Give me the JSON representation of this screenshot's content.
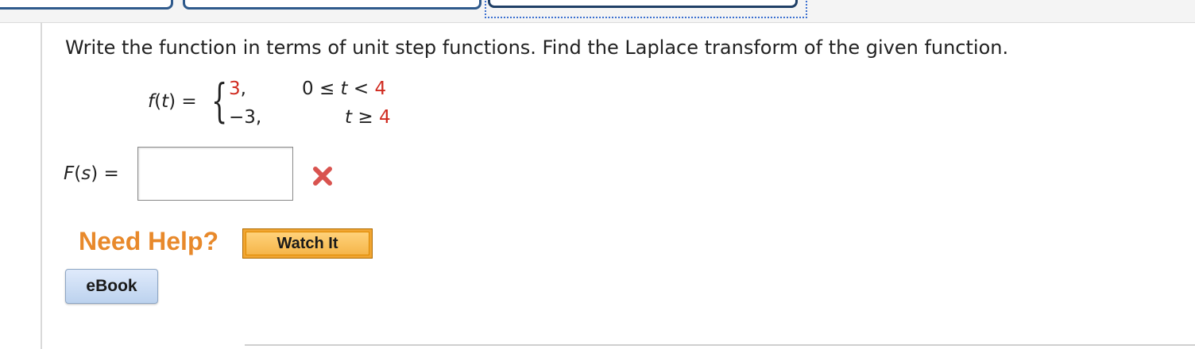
{
  "question": "Write the function in terms of unit step functions. Find the Laplace transform of the given function.",
  "function_def": {
    "lhs": "f(t) =",
    "cases": [
      {
        "value": "3",
        "comma": ",",
        "cond_prefix": "0 ≤ ",
        "cond_var": "t",
        "cond_op": " < ",
        "cond_bound": "4"
      },
      {
        "value": "−3",
        "comma": ",",
        "cond_prefix": "",
        "cond_var": "t",
        "cond_op": " ≥ ",
        "cond_bound": "4"
      }
    ]
  },
  "answer": {
    "label": "F(s) =",
    "value": "",
    "status_icon": "wrong-x-icon",
    "status_color": "#d9534f"
  },
  "help": {
    "title": "Need Help?",
    "watch_label": "Watch It",
    "ebook_label": "eBook"
  },
  "colors": {
    "accent_red": "#d02b20",
    "help_orange": "#e8892b",
    "tab_border": "#2f5a8c"
  }
}
